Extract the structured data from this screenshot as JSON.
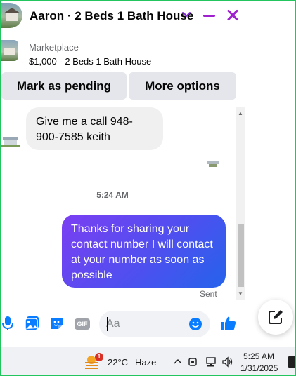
{
  "header": {
    "title": "Aaron · 2 Beds 1 Bath House"
  },
  "listing": {
    "label": "Marketplace",
    "price_title": "$1,000 - 2 Beds 1 Bath House"
  },
  "actions": {
    "pending_label": "Mark as pending",
    "more_label": "More options"
  },
  "messages": [
    {
      "direction": "incoming",
      "text": "Give me a call 948-900-7585 keith"
    },
    {
      "direction": "outgoing",
      "text": "Thanks for sharing your contact number I will contact at your number as soon as possible"
    }
  ],
  "timestamp": "5:24 AM",
  "sent_status": "Sent",
  "composer": {
    "placeholder": "Aa",
    "gif_label": "GIF"
  },
  "taskbar": {
    "weather_badge": "1",
    "temperature": "22°C",
    "condition": "Haze",
    "time": "5:25 AM",
    "date": "1/31/2025"
  },
  "colors": {
    "accent": "#a020d0",
    "messenger_blue": "#0a7cff",
    "bubble_gradient_start": "#7b3ff2",
    "bubble_gradient_end": "#2563eb",
    "frame": "#22c55e"
  },
  "icons": {
    "header": [
      "chevron-down-icon",
      "minimize-icon",
      "close-icon"
    ],
    "composer": [
      "microphone-icon",
      "photo-icon",
      "sticker-icon",
      "gif-icon",
      "emoji-icon",
      "like-icon"
    ],
    "floating": "new-message-icon"
  }
}
